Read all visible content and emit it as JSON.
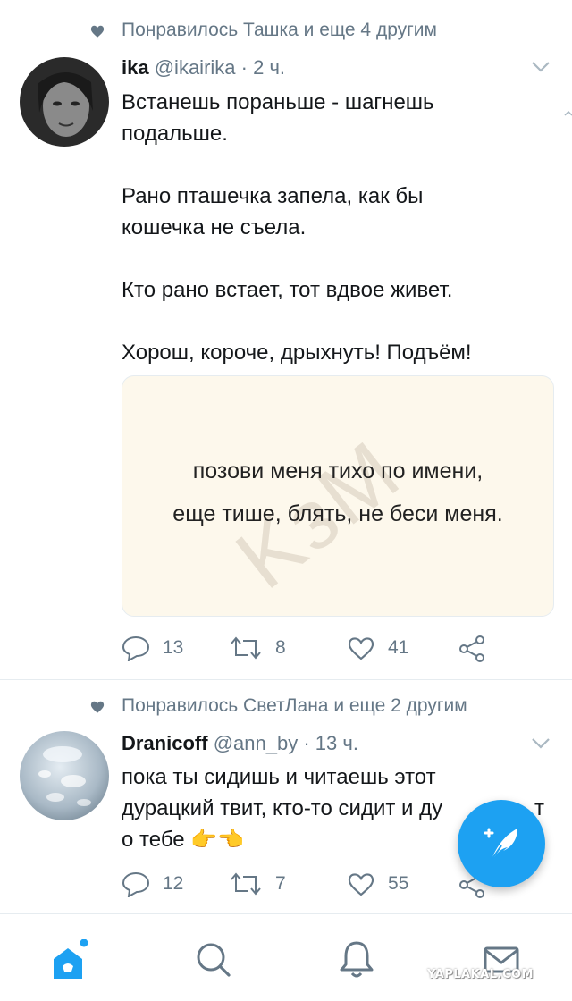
{
  "tweet1": {
    "liked_by": "Понравилось Ташка и еще 4 другим",
    "name": "ika",
    "handle": "@ikairika",
    "time": "2 ч.",
    "lines": [
      "Встанешь пораньше - шагнешь",
      "подальше.",
      "",
      "Рано пташечка запела, как бы",
      "кошечка не съела.",
      "",
      "Кто рано встает, тот вдвое живет.",
      "",
      "Хорош, короче, дрыхнуть! Подъём!"
    ],
    "media": {
      "watermark": "KзМ",
      "line1": "позови меня тихо по имени,",
      "line2": "еще тише, блять, не беси меня."
    },
    "replies": "13",
    "retweets": "8",
    "likes": "41"
  },
  "tweet2": {
    "liked_by": "Понравилось СветЛана и еще 2 другим",
    "name": "Dranicoff",
    "handle": "@ann_by",
    "time": "13 ч.",
    "lines": [
      "пока ты сидишь и читаешь этот",
      "дурацкий твит, кто-то сидит и ду",
      "о тебе"
    ],
    "line2_tail": "т",
    "emoji": "👉👈",
    "replies": "12",
    "retweets": "7",
    "likes": "55"
  },
  "footer_watermark": "YAPLAKAL.COM",
  "colors": {
    "accent": "#1da1f2",
    "muted": "#657786",
    "divider": "#e6ecf0"
  },
  "icons": {
    "compose": "compose-tweet-icon",
    "home": "home-icon",
    "search": "search-icon",
    "notifications": "bell-icon",
    "messages": "envelope-icon"
  }
}
